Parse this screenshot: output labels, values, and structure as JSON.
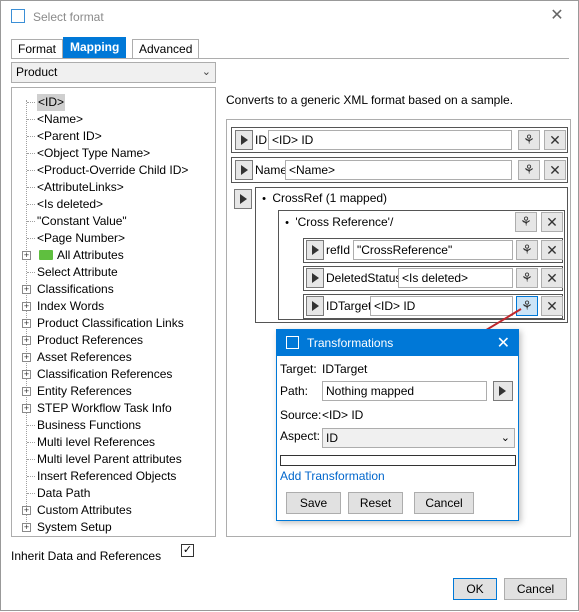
{
  "window": {
    "title": "Select format",
    "close_glyph": "✕"
  },
  "tabs": [
    {
      "label": "Format"
    },
    {
      "label": "Mapping",
      "active": true
    },
    {
      "label": "Advanced"
    }
  ],
  "object_type_select": {
    "value": "Product"
  },
  "tree": {
    "items": [
      {
        "label": "<ID>"
      },
      {
        "label": "<Name>"
      },
      {
        "label": "<Parent ID>"
      },
      {
        "label": "<Object Type Name>"
      },
      {
        "label": "<Product-Override Child ID>"
      },
      {
        "label": "<AttributeLinks>"
      },
      {
        "label": "<Is deleted>"
      },
      {
        "label": "\"Constant Value\""
      },
      {
        "label": "<Page Number>"
      },
      {
        "label": "All Attributes"
      },
      {
        "label": "Select Attribute"
      },
      {
        "label": "Classifications"
      },
      {
        "label": "Index Words"
      },
      {
        "label": "Product Classification Links"
      },
      {
        "label": "Product References"
      },
      {
        "label": "Asset References"
      },
      {
        "label": "Classification References"
      },
      {
        "label": "Entity References"
      },
      {
        "label": "STEP Workflow Task Info"
      },
      {
        "label": "Business Functions"
      },
      {
        "label": "Multi level References"
      },
      {
        "label": "Multi level Parent attributes"
      },
      {
        "label": "Insert Referenced Objects"
      },
      {
        "label": "Data Path"
      },
      {
        "label": "Custom Attributes"
      },
      {
        "label": "System Setup"
      }
    ]
  },
  "description": "Converts to a generic XML format based on a sample.",
  "mapping": {
    "id_row": {
      "label": "ID",
      "value": "<ID> ID"
    },
    "name_row": {
      "label": "Name",
      "value": "<Name>"
    },
    "crossref": {
      "label": "CrossRef (1 mapped)"
    },
    "cross_reference": {
      "label": "'Cross Reference'/"
    },
    "refid_row": {
      "label": "refId",
      "value": "\"CrossReference\""
    },
    "deleted_row": {
      "label": "DeletedStatus",
      "value": "<Is deleted>"
    },
    "idtarget_row": {
      "label": "IDTarget",
      "value": "<ID> ID"
    }
  },
  "inherit": {
    "label": "Inherit Data and References",
    "checked": true,
    "check_glyph": "✓"
  },
  "buttons": {
    "ok": "OK",
    "cancel": "Cancel"
  },
  "transformations": {
    "title": "Transformations",
    "target_label": "Target:",
    "target_value": "IDTarget",
    "path_label": "Path:",
    "path_value": "Nothing mapped",
    "source_label": "Source:",
    "source_value": "<ID> ID",
    "aspect_label": "Aspect:",
    "aspect_value": "ID",
    "add_link": "Add Transformation",
    "save": "Save",
    "reset": "Reset",
    "cancel": "Cancel",
    "close_glyph": "✕"
  },
  "colors": {
    "accent": "#0078d7",
    "arrow": "#c0282d",
    "folder": "#5fbf3f"
  }
}
